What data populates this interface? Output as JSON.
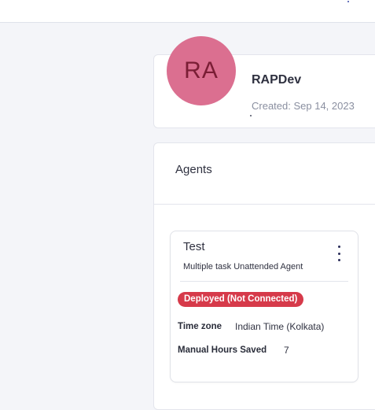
{
  "profile": {
    "initials": "RA",
    "name": "RAPDev",
    "created": "Created: Sep 14, 2023",
    "avatar_color": "#db6f90"
  },
  "agents_section": {
    "heading": "Agents"
  },
  "agent": {
    "name": "Test",
    "description": "Multiple task Unattended Agent",
    "status": "Deployed (Not Connected)",
    "status_color": "#d63a4a",
    "menu_icon": "more-vertical-icon",
    "fields": [
      {
        "label": "Time zone",
        "value": "Indian Time (Kolkata)"
      },
      {
        "label": "Manual Hours Saved",
        "value": "7"
      }
    ]
  }
}
